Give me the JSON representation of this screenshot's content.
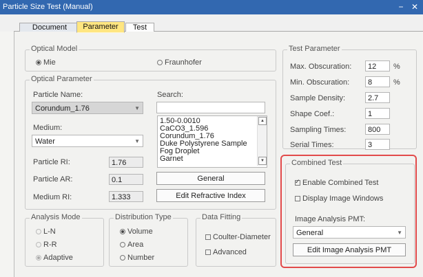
{
  "window": {
    "title": "Particle Size Test (Manual)",
    "min_icon": "minimize-icon",
    "close_icon": "close-icon"
  },
  "tabs": [
    {
      "label": "Document"
    },
    {
      "label": "Parameter",
      "active": true
    },
    {
      "label": "Test"
    }
  ],
  "optical_model": {
    "title": "Optical Model",
    "options": [
      {
        "label": "Mie",
        "selected": true
      },
      {
        "label": "Fraunhofer",
        "selected": false
      }
    ]
  },
  "optical_parameter": {
    "title": "Optical Parameter",
    "particle_name_label": "Particle Name:",
    "particle_name_value": "Corundum_1.76",
    "search_label": "Search:",
    "search_value": "",
    "medium_label": "Medium:",
    "medium_value": "Water",
    "list_items": [
      "1.50-0.0010",
      "CaCO3_1.596",
      "Corundum_1.76",
      "Duke Polystyrene Sample",
      "Fog Droplet",
      "Garnet"
    ],
    "particle_ri_label": "Particle RI:",
    "particle_ri_value": "1.76",
    "particle_ar_label": "Particle AR:",
    "particle_ar_value": "0.1",
    "medium_ri_label": "Medium RI:",
    "medium_ri_value": "1.333",
    "general_button": "General",
    "edit_ri_button": "Edit Refractive Index"
  },
  "analysis_mode": {
    "title": "Analysis Mode",
    "options": [
      {
        "label": "L-N",
        "selected": false
      },
      {
        "label": "R-R",
        "selected": false
      },
      {
        "label": "Adaptive",
        "selected": true
      }
    ]
  },
  "distribution_type": {
    "title": "Distribution Type",
    "options": [
      {
        "label": "Volume",
        "selected": true
      },
      {
        "label": "Area",
        "selected": false
      },
      {
        "label": "Number",
        "selected": false
      }
    ]
  },
  "data_fitting": {
    "title": "Data Fitting",
    "coulter_label": "Coulter-Diameter",
    "advanced_label": "Advanced"
  },
  "test_parameter": {
    "title": "Test Parameter",
    "max_obscuration_label": "Max. Obscuration:",
    "max_obscuration_value": "12",
    "min_obscuration_label": "Min. Obscuration:",
    "min_obscuration_value": "8",
    "percent_unit": "%",
    "sample_density_label": "Sample Density:",
    "sample_density_value": "2.7",
    "shape_coef_label": "Shape Coef.:",
    "shape_coef_value": "1",
    "sampling_times_label": "Sampling Times:",
    "sampling_times_value": "800",
    "serial_times_label": "Serial Times:",
    "serial_times_value": "3"
  },
  "combined_test": {
    "title": "Combined Test",
    "enable_label": "Enable Combined Test",
    "enable_checked": true,
    "display_label": "Display Image Windows",
    "display_checked": false,
    "pmt_label": "Image Analysis PMT:",
    "pmt_value": "General",
    "edit_pmt_button": "Edit Image Analysis PMT"
  },
  "colors": {
    "titlebar": "#3268b0",
    "active_tab": "#ffe680",
    "highlight": "#e24a4a"
  }
}
